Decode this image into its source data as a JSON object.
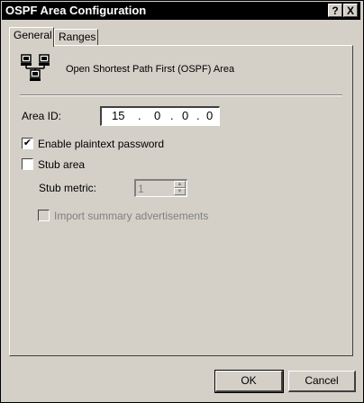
{
  "window": {
    "title": "OSPF Area Configuration",
    "help_label": "?",
    "close_label": "X"
  },
  "tabs": [
    {
      "label": "General",
      "active": true
    },
    {
      "label": "Ranges",
      "active": false
    }
  ],
  "header": {
    "icon": "network-computers-icon",
    "text": "Open Shortest Path First (OSPF) Area"
  },
  "area_id": {
    "label": "Area ID:",
    "octets": [
      "15",
      "0",
      "0",
      "0"
    ],
    "separator": "."
  },
  "enable_plaintext": {
    "label": "Enable plaintext password",
    "checked": true,
    "mark": "✔"
  },
  "stub_area": {
    "label": "Stub area",
    "checked": false
  },
  "stub_metric": {
    "label": "Stub metric:",
    "value": "1",
    "enabled": false
  },
  "import_summary": {
    "label": "Import summary advertisements",
    "checked": false,
    "enabled": false
  },
  "buttons": {
    "ok": "OK",
    "cancel": "Cancel"
  }
}
